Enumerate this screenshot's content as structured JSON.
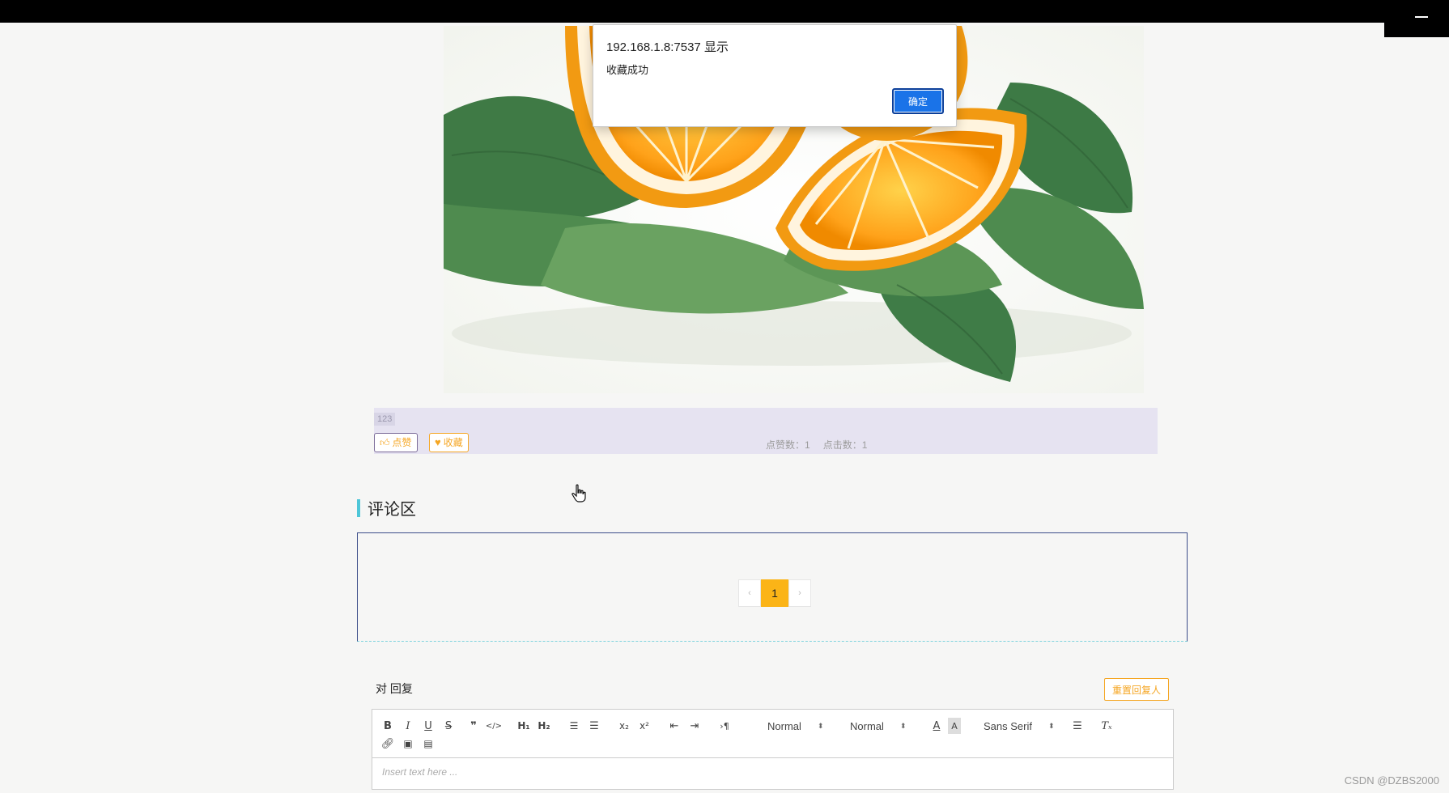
{
  "dialog": {
    "title": "192.168.1.8:7537 显示",
    "message": "收藏成功",
    "ok_label": "确定"
  },
  "post": {
    "tag": "123",
    "like_label": "点赞",
    "like_icon": "thumbs-up-icon",
    "fav_label": "收藏",
    "fav_icon": "heart-icon",
    "stats": {
      "likes_label": "点赞数：",
      "likes_value": "1",
      "clicks_label": "点击数：",
      "clicks_value": "1"
    }
  },
  "comments": {
    "title": "评论区",
    "pager": {
      "prev": "‹",
      "current": "1",
      "next": "›"
    }
  },
  "reply": {
    "label": "对 回复",
    "reset_label": "重置回复人"
  },
  "editor": {
    "header_select": "Normal",
    "size_select": "Normal",
    "font_select": "Sans Serif",
    "placeholder": "Insert text here ..."
  },
  "watermark": "CSDN @DZBS2000",
  "colors": {
    "accent": "#f5a623",
    "dialog_button": "#1a73e8",
    "pager_active": "#fbb417",
    "section_bar": "#4ec6d8",
    "infobar_bg": "#e6e3f1"
  }
}
